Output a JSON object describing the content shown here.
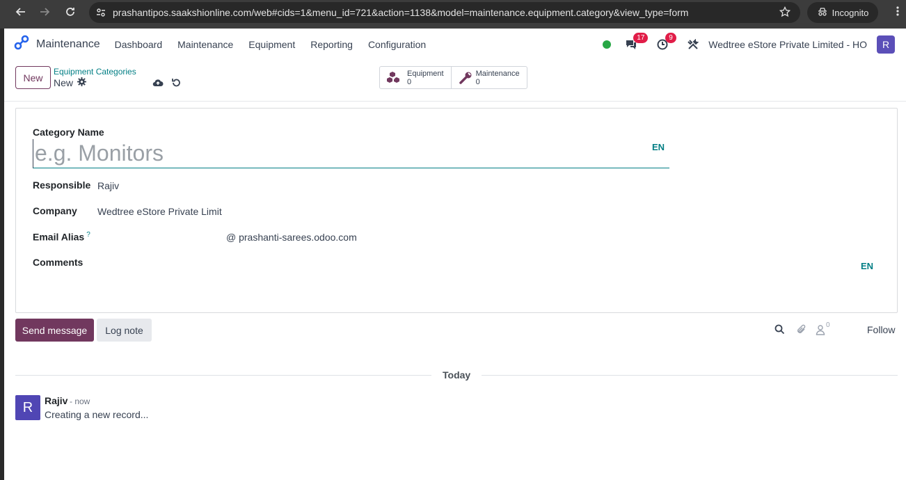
{
  "browser": {
    "url": "prashantipos.saakshionline.com/web#cids=1&menu_id=721&action=1138&model=maintenance.equipment.category&view_type=form",
    "incognito_label": "Incognito"
  },
  "navbar": {
    "app_name": "Maintenance",
    "menu": [
      "Dashboard",
      "Maintenance",
      "Equipment",
      "Reporting",
      "Configuration"
    ],
    "messages_badge": "17",
    "activities_badge": "9",
    "company": "Wedtree eStore Private Limited - HO",
    "user_initial": "R"
  },
  "control": {
    "new_button": "New",
    "breadcrumb": "Equipment Categories",
    "record_title": "New",
    "smart_buttons": [
      {
        "label": "Equipment",
        "count": "0",
        "icon": "cubes-icon"
      },
      {
        "label": "Maintenance",
        "count": "0",
        "icon": "wrench-icon"
      }
    ]
  },
  "form": {
    "category_name_label": "Category Name",
    "category_name_placeholder": "e.g. Monitors",
    "lang_label": "EN",
    "responsible_label": "Responsible",
    "responsible_value": "Rajiv",
    "company_label": "Company",
    "company_value": "Wedtree eStore Private Limit",
    "email_alias_label": "Email Alias",
    "email_alias_help": "?",
    "email_alias_domain": "@ prashanti-sarees.odoo.com",
    "comments_label": "Comments",
    "comments_lang": "EN"
  },
  "chatter": {
    "send_message": "Send message",
    "log_note": "Log note",
    "followers_count": "0",
    "follow": "Follow",
    "date_separator": "Today",
    "message": {
      "author_initial": "R",
      "author": "Rajiv",
      "time": "- now",
      "body": "Creating a new record..."
    }
  },
  "colors": {
    "brand": "#71385e",
    "accent": "#017e84",
    "presence": "#28a745",
    "badge": "#e11d48"
  }
}
